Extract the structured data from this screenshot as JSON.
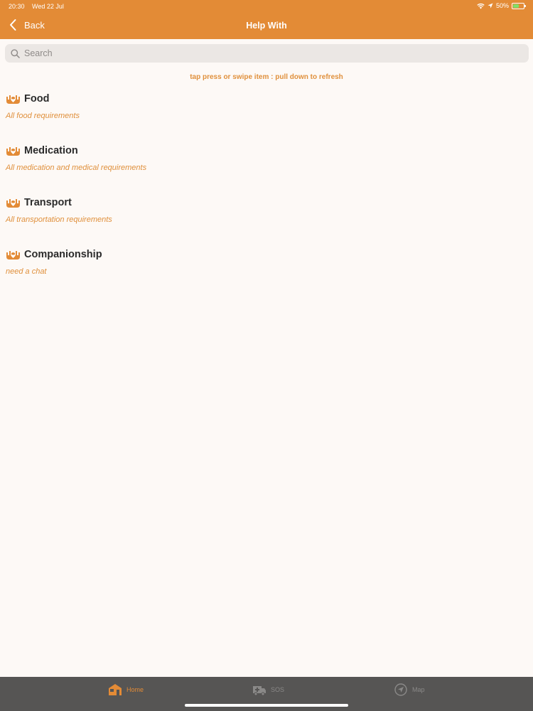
{
  "status_bar": {
    "time": "20:30",
    "date": "Wed 22 Jul",
    "battery": "50%",
    "battery_level": 0.5
  },
  "nav": {
    "back_label": "Back",
    "title": "Help With"
  },
  "search": {
    "placeholder": "Search",
    "value": ""
  },
  "hint": "tap press or swipe item : pull down to refresh",
  "items": [
    {
      "title": "Food",
      "subtitle": "All food requirements"
    },
    {
      "title": "Medication",
      "subtitle": "All medication and medical requirements"
    },
    {
      "title": "Transport",
      "subtitle": "All transportation requirements"
    },
    {
      "title": "Companionship",
      "subtitle": "need a chat"
    }
  ],
  "tabs": [
    {
      "label": "Home",
      "icon": "home-icon",
      "active": true
    },
    {
      "label": "SOS",
      "icon": "ambulance-icon",
      "active": false
    },
    {
      "label": "Map",
      "icon": "location-arrow-icon",
      "active": false
    }
  ],
  "colors": {
    "accent": "#e38b36",
    "background": "#fdf9f6",
    "tabbar": "#565554"
  }
}
